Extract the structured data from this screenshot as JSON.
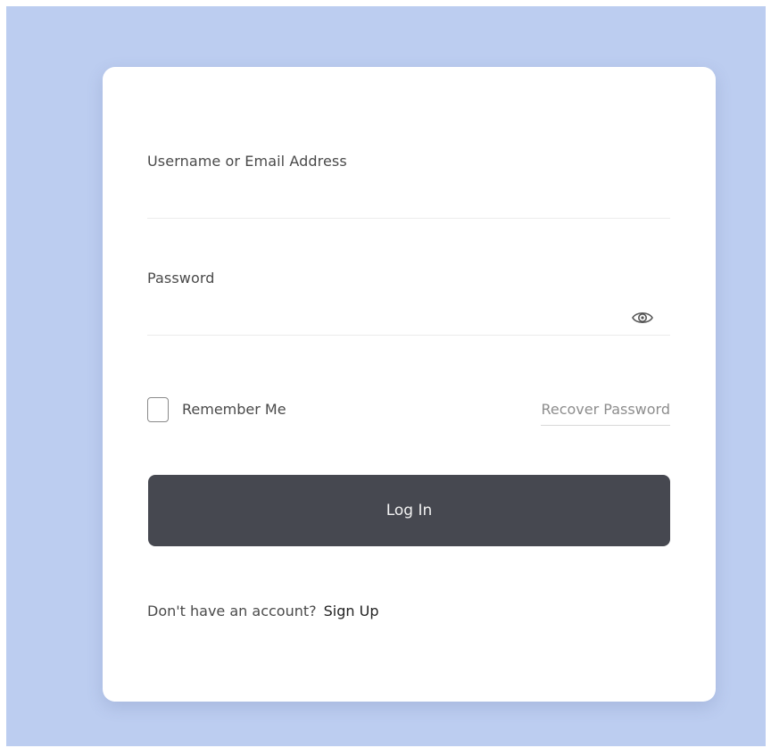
{
  "form": {
    "username_label": "Username or Email Address",
    "username_value": "",
    "password_label": "Password",
    "password_value": "",
    "remember_label": "Remember Me",
    "remember_checked": false,
    "recover_label": "Recover Password",
    "login_label": "Log In",
    "signup_prompt": "Don't have an account?",
    "signup_label": "Sign Up"
  },
  "icons": {
    "password_toggle": "eye-icon"
  },
  "colors": {
    "background": "#bccdf0",
    "card": "#ffffff",
    "button": "#464850"
  }
}
